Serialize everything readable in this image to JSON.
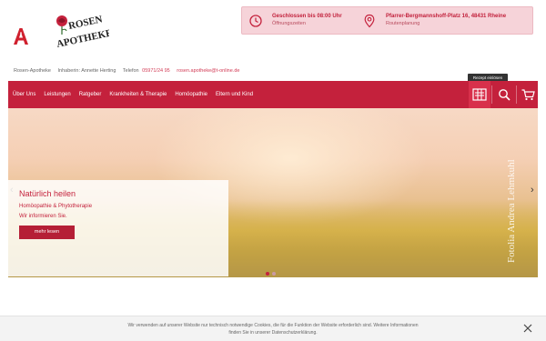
{
  "header": {
    "hours": {
      "title": "Geschlossen bis 08:00 Uhr",
      "sub": "Öffnungszeiten"
    },
    "address": {
      "title": "Pfarrer-Bergmannshoff-Platz 16, 48431 Rheine",
      "sub": "Routenplanung"
    }
  },
  "contact": {
    "name": "Rosen-Apotheke",
    "owner": "Inhaberin: Annette Herting",
    "phone_label": "Telefon",
    "phone": "05971/24 95",
    "email": "rosen.apotheke@t-online.de"
  },
  "nav": {
    "items": [
      "Über Uns",
      "Leistungen",
      "Ratgeber",
      "Krankheiten & Therapie",
      "Homöopathie",
      "Eltern und Kind"
    ],
    "tooltip": "Rezept einlösen"
  },
  "hero": {
    "title": "Natürlich heilen",
    "line1": "Homöopathie & Phytotherapie",
    "line2": "Wir informieren Sie.",
    "button": "mehr lesen",
    "watermark": "Fotolia Andrea Lehmkuhl"
  },
  "cookie": {
    "line1": "Wir verwenden auf unserer Website nur technisch notwendige Cookies, die für die Funktion der Website erforderlich sind. Weitere Informationen",
    "line2": "finden Sie in unserer Datenschutzerklärung."
  },
  "colors": {
    "brand": "#c4213c",
    "info_bg": "#f6d3d9"
  }
}
